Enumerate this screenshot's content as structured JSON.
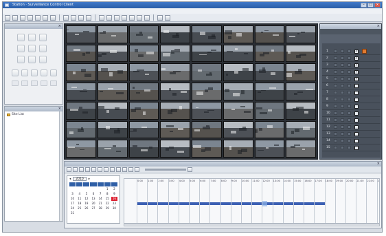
{
  "window": {
    "title": "Station · Surveillance Control Client"
  },
  "menubar": [],
  "ptz_panel": {
    "title": ""
  },
  "tree": {
    "title": "",
    "root": "Site List",
    "items": []
  },
  "left_tabs": [],
  "right_panel": {
    "title": "",
    "tabs": [],
    "rows": [
      "1",
      "2",
      "3",
      "4",
      "5",
      "6",
      "7",
      "8",
      "9",
      "10",
      "11",
      "12",
      "13",
      "14",
      "15"
    ]
  },
  "playback": {
    "title": "",
    "calendar": {
      "year_select": "2010",
      "days": [
        "",
        "",
        "",
        "",
        "",
        "1",
        "2",
        "3",
        "4",
        "5",
        "6",
        "7",
        "8",
        "9",
        "10",
        "11",
        "12",
        "13",
        "14",
        "15",
        "16",
        "17",
        "18",
        "19",
        "20",
        "21",
        "22",
        "23",
        "24",
        "25",
        "26",
        "27",
        "28",
        "29",
        "30",
        "31"
      ]
    },
    "times": [
      "0:00",
      "1:00",
      "2:00",
      "3:00",
      "4:00",
      "5:00",
      "6:00",
      "7:00",
      "8:00",
      "9:00",
      "10:00",
      "11:00",
      "12:00",
      "13:00",
      "14:00",
      "15:00",
      "16:00",
      "17:00",
      "18:00",
      "19:00",
      "20:00",
      "21:00",
      "22:00",
      "23:00"
    ]
  },
  "status_buttons": []
}
